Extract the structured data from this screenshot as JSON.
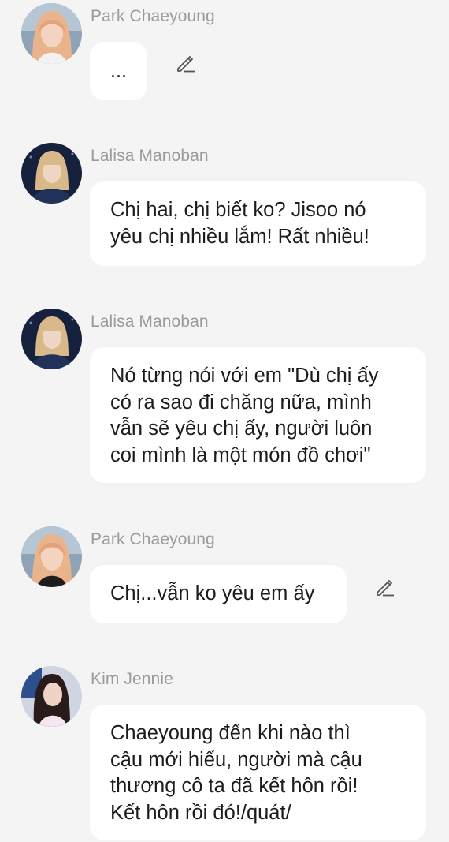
{
  "messages": [
    {
      "sender": "Park Chaeyoung",
      "avatar": "chaeyoung-avatar",
      "lines": [
        "..."
      ],
      "editable": true
    },
    {
      "sender": "Lalisa Manoban",
      "avatar": "lalisa-avatar",
      "lines": [
        "Chị hai, chị biết ko? Jisoo nó",
        "yêu chị nhiều lắm! Rất nhiều!"
      ],
      "editable": false
    },
    {
      "sender": "Lalisa Manoban",
      "avatar": "lalisa-avatar",
      "lines": [
        "Nó từng nói với em \"Dù chị ấy",
        "có ra sao đi chăng nữa, mình",
        "vẫn sẽ yêu chị ấy, người luôn",
        "coi mình là một món đồ chơi\""
      ],
      "editable": false
    },
    {
      "sender": "Park Chaeyoung",
      "avatar": "chaeyoung-avatar",
      "lines": [
        "Chị...vẫn ko yêu em ấy"
      ],
      "editable": true
    },
    {
      "sender": "Kim Jennie",
      "avatar": "jennie-avatar",
      "lines": [
        "Chaeyoung đến khi nào thì",
        "cậu mới hiểu, người mà cậu",
        "thương cô ta đã kết hôn rồi!",
        "Kết hôn rồi đó!/quát/"
      ],
      "editable": false
    }
  ],
  "icons": {
    "edit": "pencil-icon"
  },
  "colors": {
    "background": "#f4f4f4",
    "bubble": "#ffffff",
    "sender_name": "#9b9b9b",
    "text": "#1c1c1c",
    "edit_icon": "#555555"
  }
}
